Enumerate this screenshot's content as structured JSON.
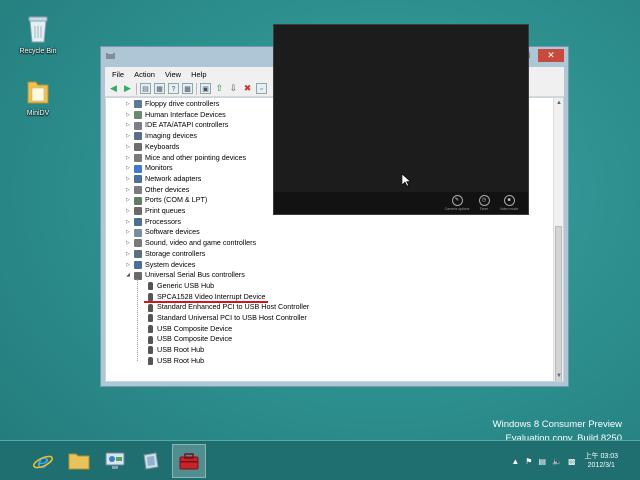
{
  "desktop": {
    "icons": [
      {
        "label": "Recycle Bin",
        "icon": "recycle-bin-icon"
      },
      {
        "label": "MiniDV",
        "icon": "folder-icon"
      }
    ]
  },
  "device_manager": {
    "menu": [
      "File",
      "Action",
      "View",
      "Help"
    ],
    "tree": [
      {
        "label": "Floppy drive controllers",
        "icon": "floppy-icon",
        "expanded": false
      },
      {
        "label": "Human Interface Devices",
        "icon": "hid-icon",
        "expanded": false
      },
      {
        "label": "IDE ATA/ATAPI controllers",
        "icon": "ide-icon",
        "expanded": false
      },
      {
        "label": "Imaging devices",
        "icon": "camera-icon",
        "expanded": false
      },
      {
        "label": "Keyboards",
        "icon": "keyboard-icon",
        "expanded": false
      },
      {
        "label": "Mice and other pointing devices",
        "icon": "mouse-icon",
        "expanded": false
      },
      {
        "label": "Monitors",
        "icon": "monitor-icon",
        "expanded": false
      },
      {
        "label": "Network adapters",
        "icon": "network-icon",
        "expanded": false
      },
      {
        "label": "Other devices",
        "icon": "unknown-device-icon",
        "expanded": false
      },
      {
        "label": "Ports (COM & LPT)",
        "icon": "port-icon",
        "expanded": false
      },
      {
        "label": "Print queues",
        "icon": "printer-icon",
        "expanded": false
      },
      {
        "label": "Processors",
        "icon": "cpu-icon",
        "expanded": false
      },
      {
        "label": "Software devices",
        "icon": "software-icon",
        "expanded": false
      },
      {
        "label": "Sound, video and game controllers",
        "icon": "speaker-icon",
        "expanded": false
      },
      {
        "label": "Storage controllers",
        "icon": "storage-icon",
        "expanded": false
      },
      {
        "label": "System devices",
        "icon": "system-icon",
        "expanded": false
      },
      {
        "label": "Universal Serial Bus controllers",
        "icon": "usb-icon",
        "expanded": true
      }
    ],
    "usb_children": [
      "Generic USB Hub",
      "SPCA1528 Video Interrupt Device",
      "Standard Enhanced PCI to USB Host Controller",
      "Standard Universal PCI to USB Host Controller",
      "USB Composite Device",
      "USB Composite Device",
      "USB Root Hub",
      "USB Root Hub"
    ],
    "highlighted_child": "SPCA1528 Video Interrupt Device",
    "highlight_color": "#d2161b"
  },
  "video_window": {
    "controls": [
      {
        "label": "Camera options",
        "icon": "camera-options-icon"
      },
      {
        "label": "Timer",
        "icon": "timer-icon"
      },
      {
        "label": "Video mode",
        "icon": "video-mode-icon"
      }
    ]
  },
  "watermark": {
    "line1": "Windows 8 Consumer Preview",
    "line2": "Evaluation copy. Build 8250"
  },
  "taskbar": {
    "apps": [
      {
        "name": "internet-explorer",
        "icon": "ie-icon"
      },
      {
        "name": "file-explorer",
        "icon": "folder-icon"
      },
      {
        "name": "control-panel",
        "icon": "control-panel-icon"
      },
      {
        "name": "app",
        "icon": "app-icon"
      },
      {
        "name": "device-manager",
        "icon": "toolbox-icon",
        "active": true
      }
    ],
    "clock": {
      "time": "上午 03:03",
      "date": "2012/3/1"
    }
  }
}
